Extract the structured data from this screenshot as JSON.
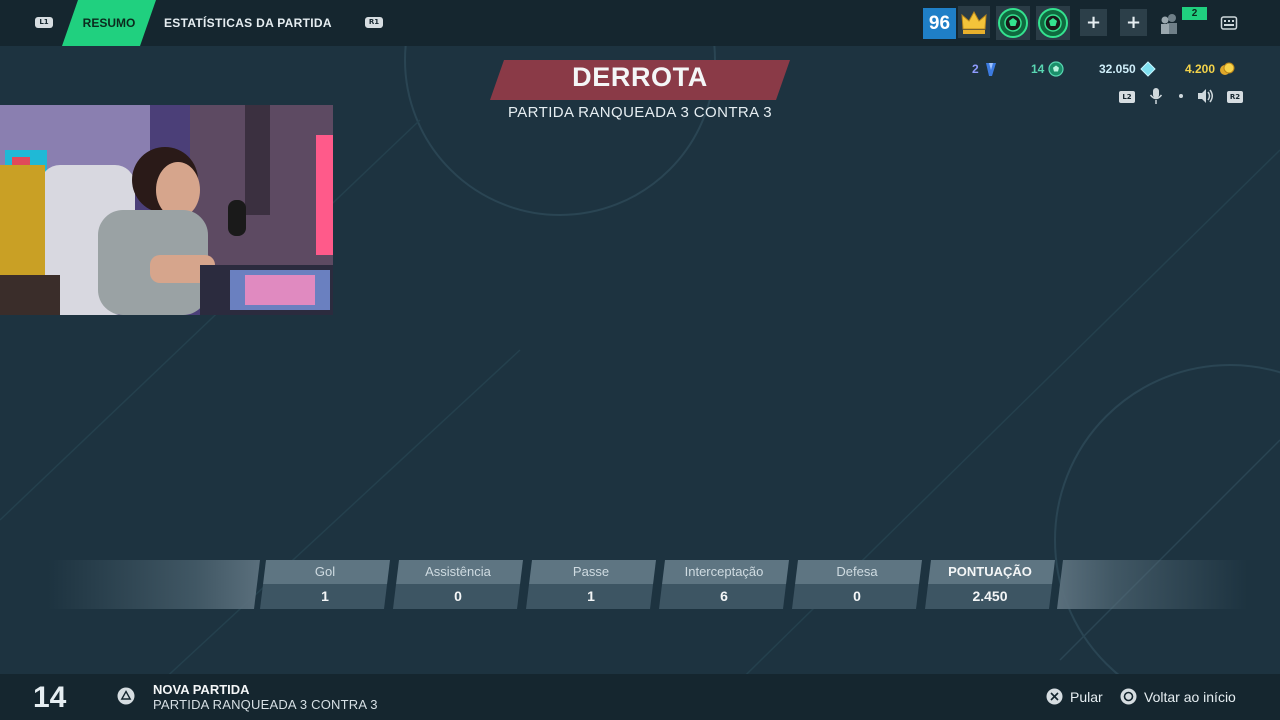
{
  "header": {
    "left_shoulder": "L1",
    "right_shoulder": "R1",
    "tabs": [
      {
        "label": "RESUMO",
        "active": true
      },
      {
        "label": "ESTATÍSTICAS DA PARTIDA",
        "active": false
      }
    ],
    "player_level": "96",
    "friends_online": "2",
    "icons": [
      "crown-icon",
      "ball-badge-icon",
      "ball-badge-icon",
      "plus-icon",
      "plus-icon",
      "friends-icon",
      "menu-icon"
    ]
  },
  "result": {
    "title": "DERROTA",
    "subtitle": "PARTIDA RANQUEADA 3 CONTRA 3",
    "banner_color": "#8a3a47"
  },
  "currencies": [
    {
      "value": "2",
      "icon": "rank-gem-icon",
      "color": "#8f9cff"
    },
    {
      "value": "14",
      "icon": "ball-token-icon",
      "color": "#59d6b2"
    },
    {
      "value": "32.050",
      "icon": "diamond-icon",
      "color": "#cfeef9"
    },
    {
      "value": "4.200",
      "icon": "coins-icon",
      "color": "#f3d34a"
    }
  ],
  "controls": {
    "left": "L2",
    "right": "R2",
    "icons": [
      "microphone-icon",
      "speaker-icon"
    ]
  },
  "stats": {
    "columns": [
      {
        "label": "Gol",
        "value": "1"
      },
      {
        "label": "Assistência",
        "value": "0"
      },
      {
        "label": "Passe",
        "value": "1"
      },
      {
        "label": "Interceptação",
        "value": "6"
      },
      {
        "label": "Defesa",
        "value": "0"
      },
      {
        "label": "PONTUAÇÃO",
        "value": "2.450"
      }
    ]
  },
  "footer": {
    "queue_number": "14",
    "next_title": "NOVA PARTIDA",
    "next_subtitle": "PARTIDA RANQUEADA 3 CONTRA 3",
    "skip_label": "Pular",
    "back_label": "Voltar ao início"
  },
  "colors": {
    "accent": "#20d07f",
    "background": "#1d3340",
    "bar": "#15262f"
  }
}
